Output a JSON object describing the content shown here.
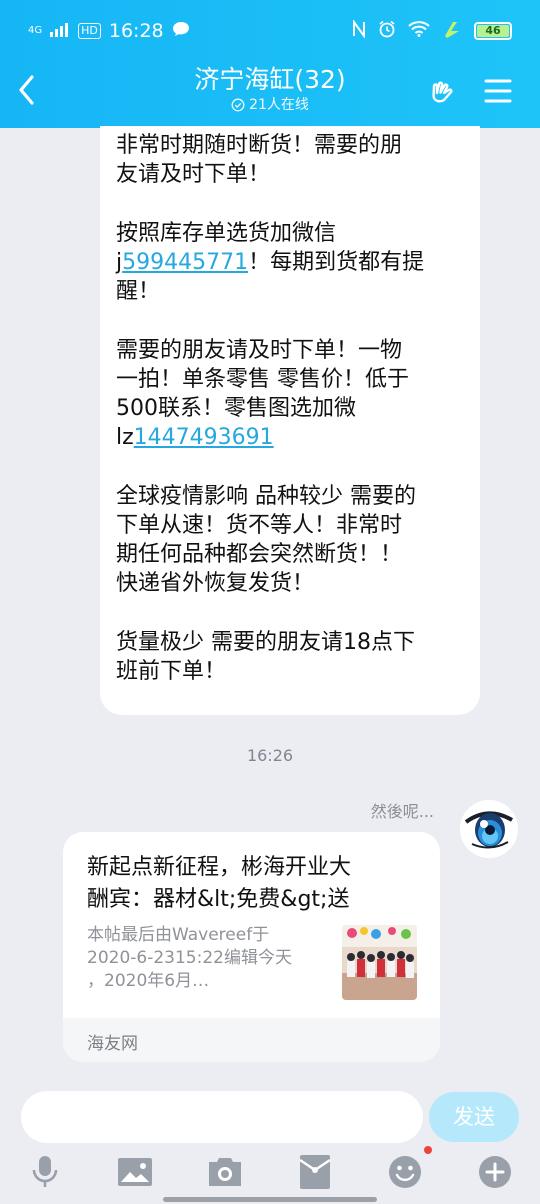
{
  "status_bar": {
    "network": "4G",
    "hd": "HD",
    "time": "16:28",
    "battery": "46"
  },
  "header": {
    "title": "济宁海缸(32)",
    "online": "21人在线"
  },
  "message": {
    "lines": {
      "l1": "非常时期随时断货！需要的朋",
      "l2": "友请及时下单！",
      "l3": "按照库存单选货加微信",
      "l4_prefix": "j",
      "l4_link": "599445771",
      "l4_suffix": "！每期到货都有提",
      "l5": "醒！",
      "l6": "需要的朋友请及时下单！一物",
      "l7": "一拍！单条零售 零售价！低于",
      "l8": "500联系！零售图选加微",
      "l9_prefix": "lz",
      "l9_link": "1447493691",
      "l10": "全球疫情影响 品种较少 需要的",
      "l11": "下单从速！货不等人！非常时",
      "l12": "期任何品种都会突然断货！！",
      "l13": "快递省外恢复发货！",
      "l14": "货量极少 需要的朋友请18点下",
      "l15": "班前下单！"
    }
  },
  "timestamp": "16:26",
  "sender": {
    "nickname": "然後呢..."
  },
  "card": {
    "title_l1": "新起点新征程，彬海开业大",
    "title_l2": "酬宾：器材&lt;免费&gt;送",
    "desc_l1": "本帖最后由Wavereef于",
    "desc_l2": "2020-6-2315:22编辑今天",
    "desc_l3": "，2020年6月…",
    "source": "海友网"
  },
  "composer": {
    "send_label": "发送"
  },
  "colors": {
    "header": "#1bbef7",
    "link": "#26a7e0",
    "send_disabled": "#b6e8fb",
    "badge": "#f0423b"
  },
  "icons": [
    "mic-icon",
    "image-icon",
    "camera-icon",
    "red-packet-icon",
    "emoji-icon",
    "plus-icon"
  ]
}
